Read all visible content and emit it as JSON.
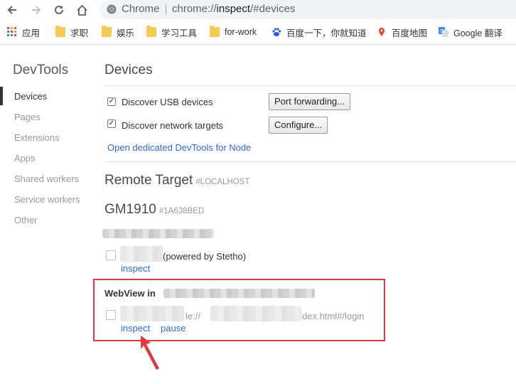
{
  "browser": {
    "site_label": "Chrome",
    "url_prefix": "chrome://",
    "url_host": "inspect",
    "url_path": "/#devices"
  },
  "bookmarks": [
    {
      "label": "应用",
      "icon": "apps-grid-icon"
    },
    {
      "label": "求职",
      "icon": "folder-icon"
    },
    {
      "label": "娱乐",
      "icon": "folder-icon"
    },
    {
      "label": "学习工具",
      "icon": "folder-icon"
    },
    {
      "label": "for-work",
      "icon": "folder-icon"
    },
    {
      "label": "百度一下，你就知道",
      "icon": "baidu-paw-icon"
    },
    {
      "label": "百度地图",
      "icon": "map-pin-icon"
    },
    {
      "label": "Google 翻译",
      "icon": "google-translate-icon"
    }
  ],
  "sidebar": {
    "title": "DevTools",
    "items": [
      "Devices",
      "Pages",
      "Extensions",
      "Apps",
      "Shared workers",
      "Service workers",
      "Other"
    ],
    "active": "Devices"
  },
  "main": {
    "title": "Devices",
    "discover_usb": {
      "label": "Discover USB devices",
      "checked": true
    },
    "discover_network": {
      "label": "Discover network targets",
      "checked": true
    },
    "port_forwarding_button": "Port forwarding...",
    "configure_button": "Configure...",
    "node_link": "Open dedicated DevTools for Node",
    "remote_target": {
      "title": "Remote Target",
      "tag": "#LOCALHOST"
    },
    "device": {
      "name": "GM1910",
      "id": "#1A638BED"
    },
    "app_target": {
      "suffix": "(powered by Stetho)",
      "inspect_link": "inspect"
    },
    "webview": {
      "heading": "WebView in",
      "url_prefix": "le://",
      "url_suffix": "dex.html#/login",
      "inspect_link": "inspect",
      "pause_link": "pause"
    }
  },
  "colors": {
    "link": "#3367d6",
    "highlight_box": "#e0383f",
    "folder": "#f9ca53"
  }
}
